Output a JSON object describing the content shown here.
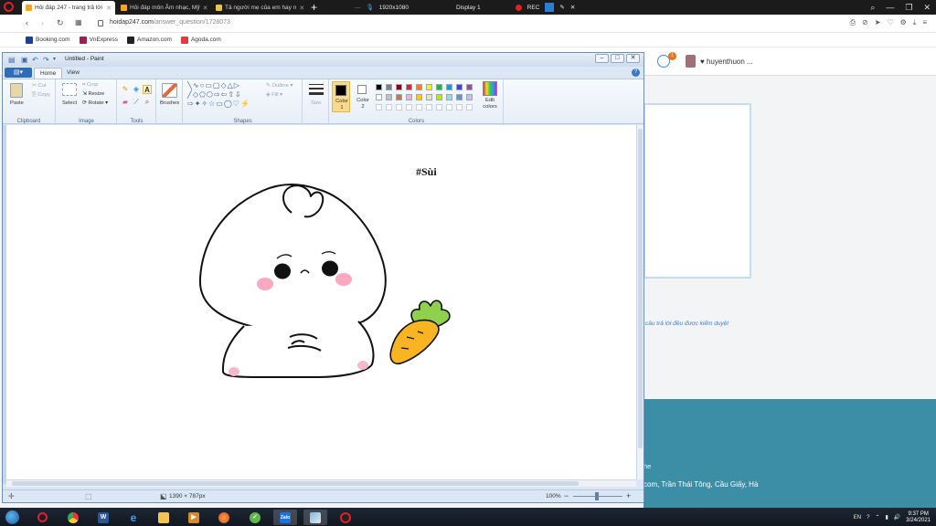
{
  "browser": {
    "tabs": [
      {
        "label": "Hỏi đáp 247 - trang trả lời",
        "active": true,
        "favicon_color": "#f4a623"
      },
      {
        "label": "Hỏi đáp môn Âm nhạc, Mỹ",
        "active": false,
        "favicon_color": "#f4a623"
      },
      {
        "label": "Tả người mẹ của em hay n",
        "active": false,
        "favicon_color": "#e8c34b"
      }
    ],
    "new_tab": "+",
    "recorder": {
      "resolution": "1920x1080",
      "display": "Display 1",
      "rec_label": "REC"
    },
    "url_domain": "hoidap247.com",
    "url_path": "/answer_question/1728073",
    "bookmarks": [
      {
        "label": "Booking.com",
        "color": "#1c3f94"
      },
      {
        "label": "VnExpress",
        "color": "#9f224e"
      },
      {
        "label": "Amazon.com",
        "color": "#222222"
      },
      {
        "label": "Agoda.com",
        "color": "#e43c3c"
      }
    ]
  },
  "site": {
    "username": "♥ huyenthuon ...",
    "notification_count": "1",
    "card_note": "câu trả lời đều được kiểm duyệt",
    "footer_line1": "he",
    "footer_line2": "com, Trần Thái Tông, Cầu Giấy, Hà",
    "footer_color": "#3b8ea6"
  },
  "paint": {
    "title": "Untitled - Paint",
    "tabs": [
      {
        "label": "Home",
        "active": true
      },
      {
        "label": "View",
        "active": false
      }
    ],
    "groups": {
      "clipboard": {
        "label": "Clipboard",
        "paste": "Paste",
        "cut": "Cut",
        "copy": "Copy"
      },
      "image": {
        "label": "Image",
        "select": "Select",
        "crop": "Crop",
        "resize": "Resize",
        "rotate": "Rotate"
      },
      "tools": {
        "label": "Tools"
      },
      "brushes": {
        "label": "Brushes"
      },
      "shapes": {
        "label": "Shapes",
        "outline": "Outline",
        "fill": "Fill"
      },
      "size": {
        "label": "Size"
      },
      "colors": {
        "label": "Colors",
        "color1_label": "Color 1",
        "color2_label": "Color 2",
        "edit_colors": "Edit colors",
        "color1": "#000000",
        "color2": "#ffffff",
        "palette_row1": [
          "#000000",
          "#7f7f7f",
          "#880015",
          "#ed1c24",
          "#ff7f27",
          "#fff200",
          "#22b14c",
          "#00a2e8",
          "#3f48cc",
          "#a349a4"
        ],
        "palette_row2": [
          "#ffffff",
          "#c3c3c3",
          "#b97a57",
          "#ffaec9",
          "#ffc90e",
          "#efe4b0",
          "#b5e61d",
          "#99d9ea",
          "#7092be",
          "#c8bfe7"
        ]
      }
    },
    "canvas_text": "#Sùi",
    "status_size": "1390 × 787px",
    "zoom": "100%",
    "zoom_minus": "−",
    "zoom_plus": "+"
  },
  "taskbar": {
    "apps": [
      "opera",
      "chrome",
      "word",
      "internet-explorer",
      "file-explorer",
      "media-player",
      "firefox",
      "greenshot",
      "zalo",
      "paint",
      "recorder"
    ],
    "time": "9:37 PM",
    "date": "3/24/2021",
    "lang": "EN"
  }
}
